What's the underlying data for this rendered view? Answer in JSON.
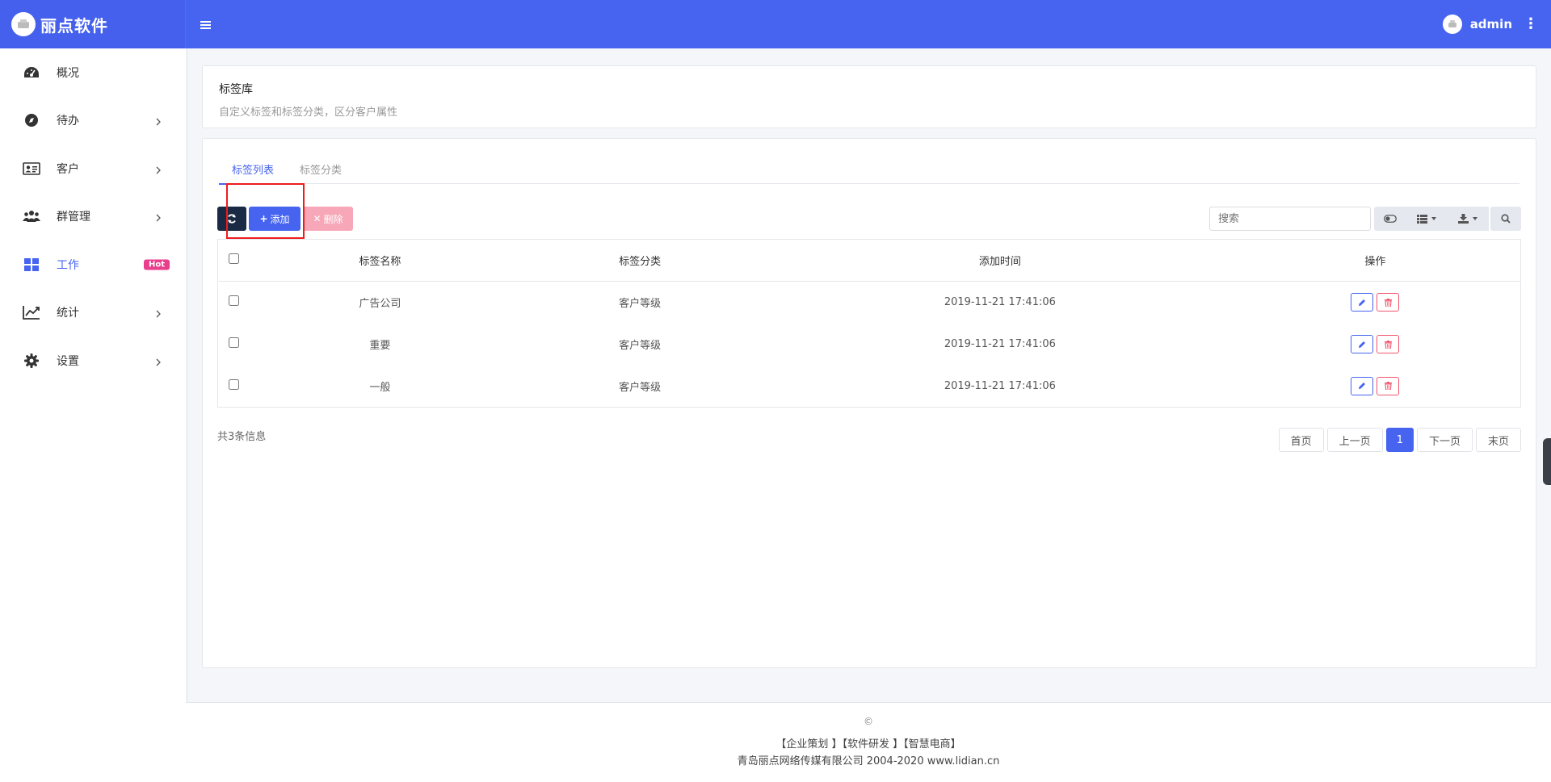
{
  "app": {
    "brand_name": "丽点软件",
    "username": "admin"
  },
  "sidebar": {
    "items": [
      {
        "label": "概况",
        "icon": "dashboard-icon",
        "has_children": false
      },
      {
        "label": "待办",
        "icon": "compass-icon",
        "has_children": true
      },
      {
        "label": "客户",
        "icon": "id-card-icon",
        "has_children": true
      },
      {
        "label": "群管理",
        "icon": "users-icon",
        "has_children": true
      },
      {
        "label": "工作",
        "icon": "grid-icon",
        "has_children": false,
        "active": true,
        "badge": "Hot"
      },
      {
        "label": "统计",
        "icon": "line-chart-icon",
        "has_children": true
      },
      {
        "label": "设置",
        "icon": "gear-icon",
        "has_children": true
      }
    ]
  },
  "header": {
    "title": "标签库",
    "description": "自定义标签和标签分类，区分客户属性"
  },
  "tabs": [
    {
      "label": "标签列表",
      "active": true
    },
    {
      "label": "标签分类",
      "active": false
    }
  ],
  "toolbar": {
    "add_label": "添加",
    "delete_label": "删除",
    "search_placeholder": "搜索"
  },
  "table": {
    "columns": [
      "标签名称",
      "标签分类",
      "添加时间",
      "操作"
    ],
    "rows": [
      {
        "name": "广告公司",
        "category": "客户等级",
        "time": "2019-11-21 17:41:06"
      },
      {
        "name": "重要",
        "category": "客户等级",
        "time": "2019-11-21 17:41:06"
      },
      {
        "name": "一般",
        "category": "客户等级",
        "time": "2019-11-21 17:41:06"
      }
    ]
  },
  "pagination": {
    "total_text": "共3条信息",
    "first": "首页",
    "prev": "上一页",
    "current": "1",
    "next": "下一页",
    "last": "末页"
  },
  "footer": {
    "copyright": "©",
    "links": "【企业策划 】【软件研发 】【智慧电商】",
    "company": "青岛丽点网络传媒有限公司 2004-2020 www.lidian.cn"
  },
  "colors": {
    "primary": "#4664f0",
    "hot_badge": "#e83e8c",
    "danger": "#f1556c",
    "highlight": "#ee1c1c"
  }
}
